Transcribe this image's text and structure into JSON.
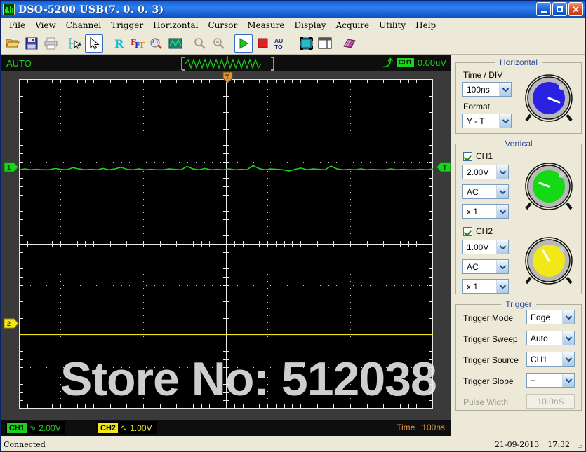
{
  "window": {
    "title": "DSO-5200  USB(7. 0. 0. 3)",
    "icon": "scope-waveform-icon",
    "buttons": {
      "minimize": "minimize",
      "maximize": "maximize",
      "close": "close"
    }
  },
  "menubar": {
    "items": [
      {
        "label": "File",
        "accel": "F"
      },
      {
        "label": "View",
        "accel": "V"
      },
      {
        "label": "Channel",
        "accel": "C"
      },
      {
        "label": "Trigger",
        "accel": "T"
      },
      {
        "label": "Horizontal",
        "accel": "H"
      },
      {
        "label": "Cursor",
        "accel": "r"
      },
      {
        "label": "Measure",
        "accel": "M"
      },
      {
        "label": "Display",
        "accel": "D"
      },
      {
        "label": "Acquire",
        "accel": "A"
      },
      {
        "label": "Utility",
        "accel": "U"
      },
      {
        "label": "Help",
        "accel": "H"
      }
    ]
  },
  "toolbar": {
    "items": [
      {
        "name": "open-icon",
        "title": "Open"
      },
      {
        "name": "save-icon",
        "title": "Save"
      },
      {
        "name": "print-icon",
        "title": "Print"
      },
      {
        "name": "cursor-measure-icon",
        "title": "Cursor Measure"
      },
      {
        "name": "select-pointer-icon",
        "title": "Select",
        "active": true
      },
      {
        "name": "record-icon",
        "title": "Record"
      },
      {
        "name": "fft-icon",
        "title": "FFT"
      },
      {
        "name": "filter-icon",
        "title": "Filter"
      },
      {
        "name": "waveform-math-icon",
        "title": "Waveform Math"
      },
      {
        "name": "zoom-out-icon",
        "title": "Zoom Out"
      },
      {
        "name": "zoom-in-icon",
        "title": "Zoom In"
      },
      {
        "name": "run-icon",
        "title": "Run",
        "active": true
      },
      {
        "name": "stop-icon",
        "title": "Stop"
      },
      {
        "name": "autoset-icon",
        "title": "AUTO",
        "label": "AU\nTO"
      },
      {
        "name": "fit-screen-icon",
        "title": "Fit Screen"
      },
      {
        "name": "split-view-icon",
        "title": "Split View"
      },
      {
        "name": "help-book-icon",
        "title": "Help"
      }
    ]
  },
  "scope": {
    "topbar": {
      "mode": "AUTO",
      "trigger_slope_icon": "rising-edge-icon",
      "channel_chip": "CH1",
      "trigger_level": "0.00uV"
    },
    "markers": {
      "ch1": "1",
      "ch2": "2",
      "trigger": "T",
      "trigger_position": "T"
    },
    "watermark": "Store No: 512038",
    "bottombar": {
      "ch1": {
        "tag": "CH1",
        "coupling": "∿",
        "value": "2.00V"
      },
      "ch2": {
        "tag": "CH2",
        "coupling": "∿",
        "value": "1.00V"
      },
      "time_label": "Time",
      "time_value": "100ns"
    },
    "colors": {
      "ch1": "#19d419",
      "ch2": "#f2e817",
      "time": "#e8953a",
      "grid": "#c8c8c8",
      "background": "#000000"
    }
  },
  "panel": {
    "horizontal": {
      "legend": "Horizontal",
      "time_div_label": "Time / DIV",
      "time_div_value": "100ns",
      "format_label": "Format",
      "format_value": "Y - T",
      "knob": "horizontal-position-knob",
      "knob_color": "#2a22e0"
    },
    "vertical": {
      "legend": "Vertical",
      "ch1": {
        "label": "CH1",
        "enabled": true,
        "volts_div": "2.00V",
        "coupling": "AC",
        "probe": "x 1",
        "knob": "ch1-position-knob",
        "knob_color": "#16d916"
      },
      "ch2": {
        "label": "CH2",
        "enabled": true,
        "volts_div": "1.00V",
        "coupling": "AC",
        "probe": "x 1",
        "knob": "ch2-position-knob",
        "knob_color": "#f2e817"
      }
    },
    "trigger": {
      "legend": "Trigger",
      "rows": [
        {
          "label": "Trigger Mode",
          "value": "Edge",
          "disabled": false
        },
        {
          "label": "Trigger Sweep",
          "value": "Auto",
          "disabled": false
        },
        {
          "label": "Trigger Source",
          "value": "CH1",
          "disabled": false
        },
        {
          "label": "Trigger Slope",
          "value": "+",
          "disabled": false
        },
        {
          "label": "Pulse Width",
          "value": "10.0nS",
          "disabled": true
        }
      ]
    }
  },
  "statusbar": {
    "message": "Connected",
    "date": "21-09-2013",
    "time": "17:32"
  },
  "chart_data": {
    "type": "line",
    "title": "Oscilloscope waveform display",
    "grid": {
      "x_divisions": 10,
      "y_divisions": 8,
      "style": "dotted",
      "center_crosshair": true
    },
    "axes": {
      "x_unit_per_div": "100ns",
      "ch1_volts_per_div": "2.00V",
      "ch2_volts_per_div": "1.00V"
    },
    "series": [
      {
        "name": "CH1",
        "color": "#19d419",
        "baseline_div": 1.8,
        "values": [
          0,
          0.02,
          0,
          0.01,
          0,
          0,
          0.03,
          0.01,
          0,
          0.05,
          0.02,
          0,
          0.01,
          0,
          0.03,
          0,
          0.02,
          0.06,
          0.01,
          0,
          0.02,
          0,
          0.01,
          0,
          0,
          0.02,
          0.01,
          0,
          0.08,
          0.02,
          0,
          0.03,
          0,
          0.01,
          0,
          0.02,
          0,
          0.01,
          0,
          0.1,
          0.03,
          0,
          0.02,
          0.01,
          0,
          -0.03,
          0.01,
          0.04,
          0,
          0.02,
          0.01,
          0,
          0.09,
          0.02,
          0,
          0.01,
          0,
          0.02,
          0,
          0.01,
          0,
          0,
          0.02,
          0,
          0.01,
          0,
          0,
          0.01,
          0,
          0.02
        ]
      },
      {
        "name": "CH2",
        "color": "#f2e817",
        "baseline_div": -2.2,
        "values": [
          0,
          0,
          0,
          0,
          0,
          0,
          0,
          0,
          0,
          0,
          0,
          0,
          0,
          0,
          0,
          0,
          0,
          0,
          0,
          0,
          0,
          0,
          0,
          0,
          0,
          0,
          0,
          0,
          0,
          0,
          0,
          0,
          0,
          0,
          0,
          0,
          0,
          0,
          0,
          0,
          0,
          0,
          0,
          0,
          0,
          0,
          0,
          0,
          0,
          0,
          0,
          0,
          0,
          0,
          0,
          0,
          0,
          0,
          0,
          0,
          0,
          0,
          0,
          0,
          0,
          0,
          0,
          0,
          0,
          0
        ]
      }
    ],
    "preview": {
      "name": "trigger-preview",
      "type": "triangle-wave",
      "cycles": 13,
      "color": "#19d419"
    }
  }
}
